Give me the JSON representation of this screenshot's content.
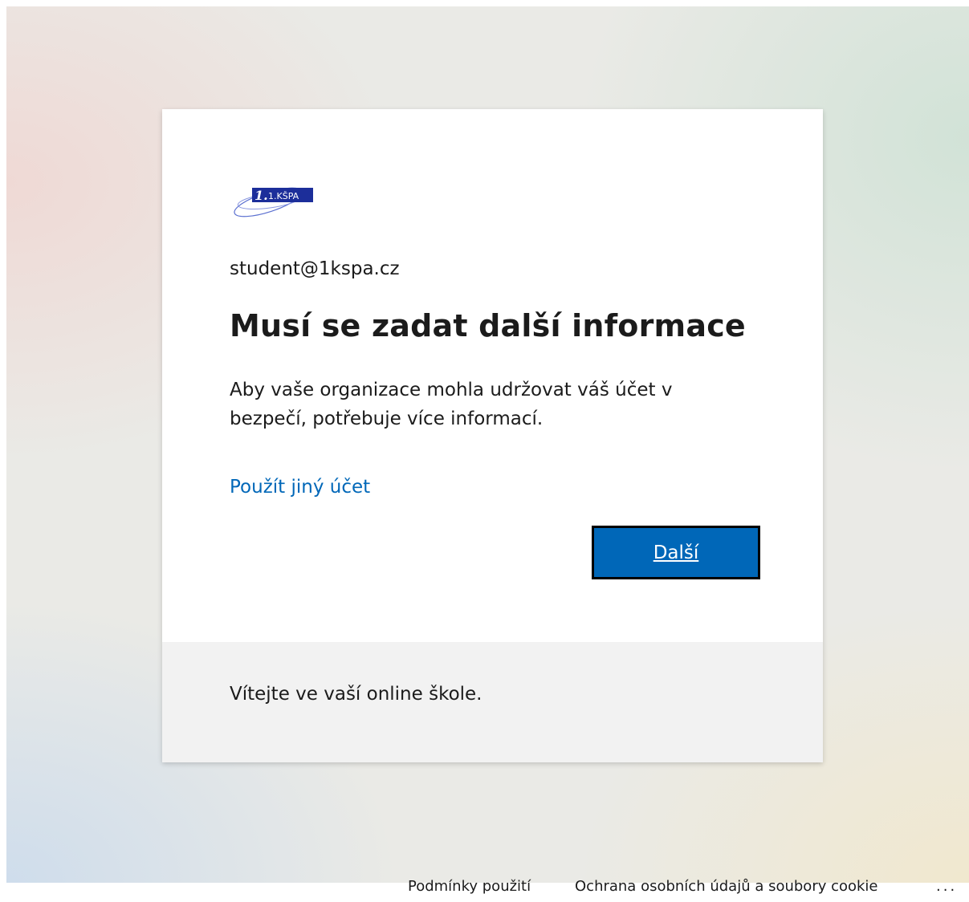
{
  "logo": {
    "text": "1.KŠPA",
    "icon": "school-logo-icon"
  },
  "account": {
    "email": "student@1kspa.cz"
  },
  "main": {
    "title": "Musí se zadat další informace",
    "description": "Aby vaše organizace mohla udržovat váš účet v bezpečí, potřebuje více informací.",
    "other_account_link": "Použít jiný účet",
    "next_button": "Další"
  },
  "card_footer": {
    "text": "Vítejte ve vaší online škole."
  },
  "page_footer": {
    "terms": "Podmínky použití",
    "privacy": "Ochrana osobních údajů a soubory cookie",
    "more": "..."
  },
  "colors": {
    "accent": "#0067b8",
    "footer_bg": "#f2f2f2"
  }
}
